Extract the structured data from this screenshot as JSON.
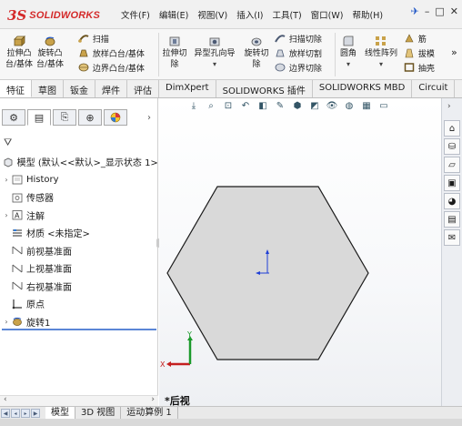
{
  "app": {
    "logo_ds": "3S",
    "logo_brand": "SOLIDWORKS"
  },
  "menu": [
    "文件(F)",
    "编辑(E)",
    "视图(V)",
    "插入(I)",
    "工具(T)",
    "窗口(W)",
    "帮助(H)"
  ],
  "window_controls": {
    "pin": "✈",
    "minimize": "–",
    "restore": "□",
    "close": "✕"
  },
  "ribbon": {
    "extrude_boss": "拉伸凸\n台/基体",
    "revolve_boss": "旋转凸\n台/基体",
    "sweep": "扫描",
    "loft_boss": "放样凸台/基体",
    "boundary_boss": "边界凸台/基体",
    "extrude_cut": "拉伸切\n除",
    "hole_wizard": "异型孔向导",
    "revolve_cut": "旋转切\n除",
    "swept_cut": "扫描切除",
    "lofted_cut": "放样切割",
    "boundary_cut": "边界切除",
    "fillet": "圆角",
    "linear_pattern": "线性阵列",
    "rib": "筋",
    "draft": "拔模",
    "shell": "抽壳",
    "overflow": "»"
  },
  "command_tabs": [
    "特征",
    "草图",
    "钣金",
    "焊件",
    "评估",
    "DimXpert",
    "SOLIDWORKS 插件",
    "SOLIDWORKS MBD",
    "Circuit"
  ],
  "feature_tree": {
    "root": "模型 (默认<<默认>_显示状态 1>)",
    "items": [
      {
        "label": "History",
        "expandable": true
      },
      {
        "label": "传感器",
        "expandable": false
      },
      {
        "label": "注解",
        "expandable": true
      },
      {
        "label": "材质 <未指定>",
        "expandable": false
      },
      {
        "label": "前视基准面",
        "expandable": false
      },
      {
        "label": "上视基准面",
        "expandable": false
      },
      {
        "label": "右视基准面",
        "expandable": false
      },
      {
        "label": "原点",
        "expandable": false
      },
      {
        "label": "旋转1",
        "expandable": true
      }
    ]
  },
  "viewport": {
    "view_name": "*后视",
    "shape_fill": "#d9d9d9",
    "shape_stroke": "#1a1a1a"
  },
  "bottom_tabs": [
    "模型",
    "3D 视图",
    "运动算例 1"
  ],
  "colors": {
    "brand_red": "#d42a2a",
    "accent_blue": "#5b86d6"
  }
}
